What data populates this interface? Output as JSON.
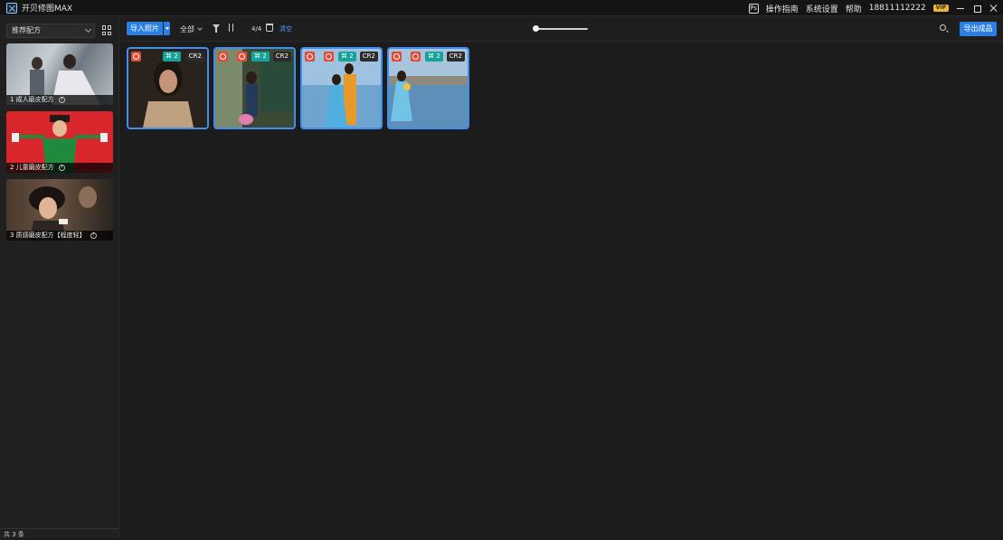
{
  "app": {
    "title": "开贝修图MAX"
  },
  "titlebar": {
    "guide_label": "操作指南",
    "settings_label": "系统设置",
    "help_label": "帮助",
    "phone": "18811112222",
    "vip_badge": "VIP"
  },
  "sidebar": {
    "preset_select": "推荐配方",
    "presets": [
      {
        "label": "1 成人磨皮配方",
        "help": "?"
      },
      {
        "label": "2 儿童磨皮配方",
        "help": "?"
      },
      {
        "label": "3 质感磨皮配方【程度轻】",
        "help": "?"
      }
    ],
    "footer": "共 3 条"
  },
  "toolbar": {
    "import_label": "导入照片",
    "filter_label": "全部",
    "count": "4/4",
    "clear_label": "清空",
    "export_label": "导出成品"
  },
  "photos": [
    {
      "count": "2",
      "format": "CR2"
    },
    {
      "count": "2",
      "format": "CR2"
    },
    {
      "count": "2",
      "format": "CR2"
    },
    {
      "count": "2",
      "format": "CR2"
    }
  ],
  "colors": {
    "accent": "#2b7fe0",
    "selection": "#3f8ef0",
    "badge_teal": "#17a39a",
    "badge_red": "#e24b3a"
  }
}
